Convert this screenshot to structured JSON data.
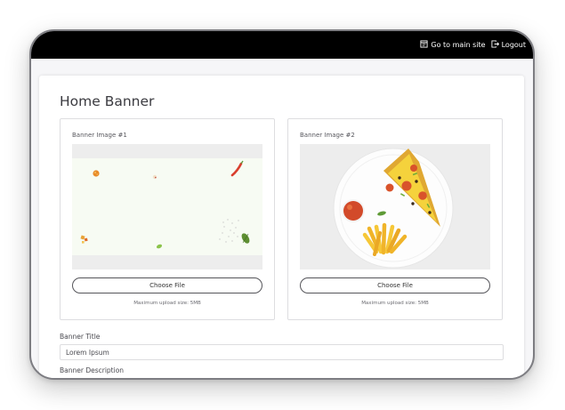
{
  "topbar": {
    "main_site_label": "Go to main site",
    "logout_label": "Logout"
  },
  "page": {
    "title": "Home Banner"
  },
  "banners": [
    {
      "label": "Banner Image #1",
      "choose_label": "Choose File",
      "note": "Maximum upload size: 5MB"
    },
    {
      "label": "Banner Image #2",
      "choose_label": "Choose File",
      "note": "Maximum upload size: 5MB"
    }
  ],
  "form": {
    "title_label": "Banner Title",
    "title_value": "Lorem Ipsum",
    "description_label": "Banner Description"
  },
  "colors": {
    "topbar": "#000000",
    "pizza_crust": "#e0a832",
    "pizza_cheese": "#f5d23c",
    "pepperoni": "#d9532b",
    "plate": "#ffffff"
  }
}
